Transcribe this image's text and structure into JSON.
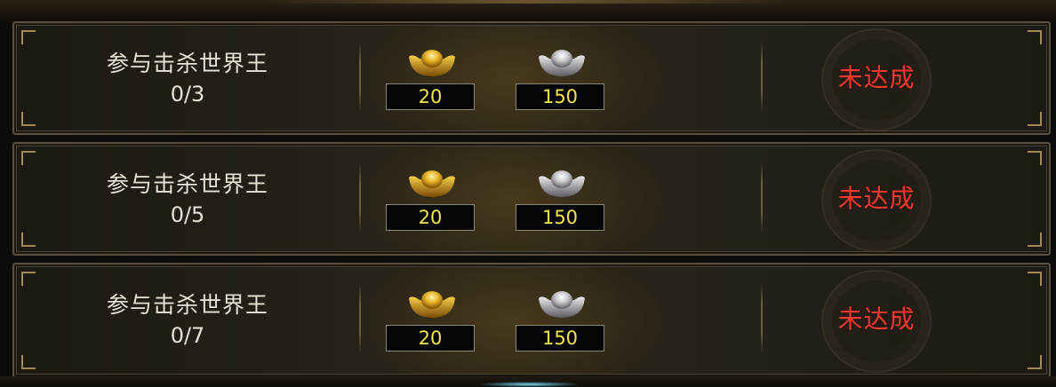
{
  "quests": [
    {
      "title": "参与击杀世界王",
      "progress": "0/3",
      "rewards": {
        "gold_amount": "20",
        "silver_amount": "150",
        "gold_icon": "gold-ingot-icon",
        "silver_icon": "silver-ingot-icon"
      },
      "status": "未达成"
    },
    {
      "title": "参与击杀世界王",
      "progress": "0/5",
      "rewards": {
        "gold_amount": "20",
        "silver_amount": "150",
        "gold_icon": "gold-ingot-icon",
        "silver_icon": "silver-ingot-icon"
      },
      "status": "未达成"
    },
    {
      "title": "参与击杀世界王",
      "progress": "0/7",
      "rewards": {
        "gold_amount": "20",
        "silver_amount": "150",
        "gold_icon": "gold-ingot-icon",
        "silver_icon": "silver-ingot-icon"
      },
      "status": "未达成"
    }
  ],
  "colors": {
    "status_incomplete": "#f03a30",
    "amount_text": "#f2e64a",
    "label_text": "#e8e2d4"
  }
}
